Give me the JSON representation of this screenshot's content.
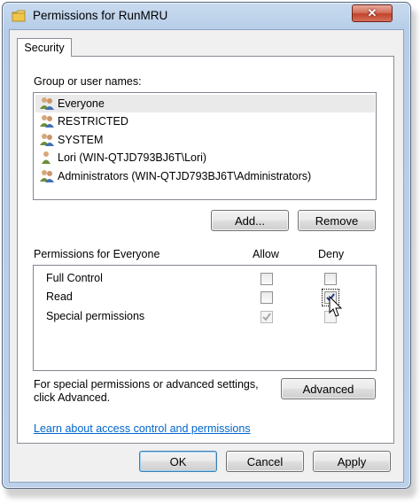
{
  "window": {
    "title": "Permissions for RunMRU",
    "close_glyph": "✕"
  },
  "tabs": [
    {
      "label": "Security"
    }
  ],
  "group_label": "Group or user names:",
  "users": [
    {
      "name": "Everyone",
      "icon": "users-icon",
      "selected": true
    },
    {
      "name": "RESTRICTED",
      "icon": "users-icon",
      "selected": false
    },
    {
      "name": "SYSTEM",
      "icon": "users-icon",
      "selected": false
    },
    {
      "name": "Lori (WIN-QTJD793BJ6T\\Lori)",
      "icon": "user-icon",
      "selected": false
    },
    {
      "name": "Administrators (WIN-QTJD793BJ6T\\Administrators)",
      "icon": "users-icon",
      "selected": false
    }
  ],
  "buttons": {
    "add": "Add...",
    "remove": "Remove",
    "advanced": "Advanced",
    "ok": "OK",
    "cancel": "Cancel",
    "apply": "Apply"
  },
  "permissions": {
    "header": "Permissions for Everyone",
    "allow_header": "Allow",
    "deny_header": "Deny",
    "rows": [
      {
        "name": "Full Control",
        "allow": false,
        "deny": false
      },
      {
        "name": "Read",
        "allow": false,
        "deny": true
      },
      {
        "name": "Special permissions",
        "allow": true,
        "deny": false
      }
    ]
  },
  "advanced_text_line1": "For special permissions or advanced settings,",
  "advanced_text_line2": "click Advanced.",
  "help_link": "Learn about access control and permissions",
  "colors": {
    "link": "#0066cc",
    "selection": "#eaeaea",
    "close_button": "#c2432a"
  }
}
